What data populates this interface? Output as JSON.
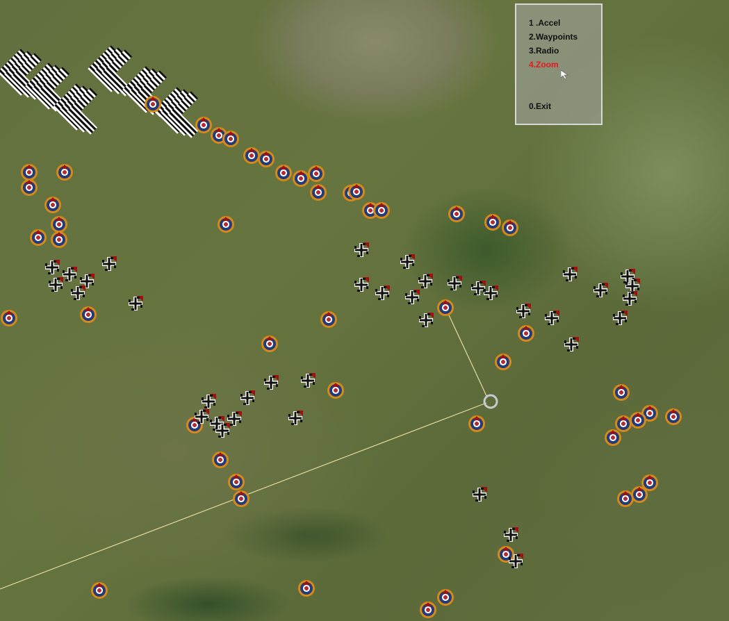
{
  "menu": {
    "items": [
      {
        "label": "1 .Accel"
      },
      {
        "label": "2.Waypoints"
      },
      {
        "label": "3.Radio"
      },
      {
        "label": "4.Zoom",
        "selected": true
      },
      {
        "label": "0.Exit"
      }
    ]
  },
  "colors": {
    "allied_ring": "#d88a18",
    "allied_blue": "#223c7a",
    "allied_red": "#b22c38",
    "heading": "#a01010",
    "selected_menu": "#e81818",
    "route_line": "#e8dca0"
  },
  "icons": {
    "allied": "raf-roundel-icon",
    "axis": "balkenkreuz-icon",
    "formation": "formation-icon",
    "waypoint": "waypoint-circle-icon"
  }
}
